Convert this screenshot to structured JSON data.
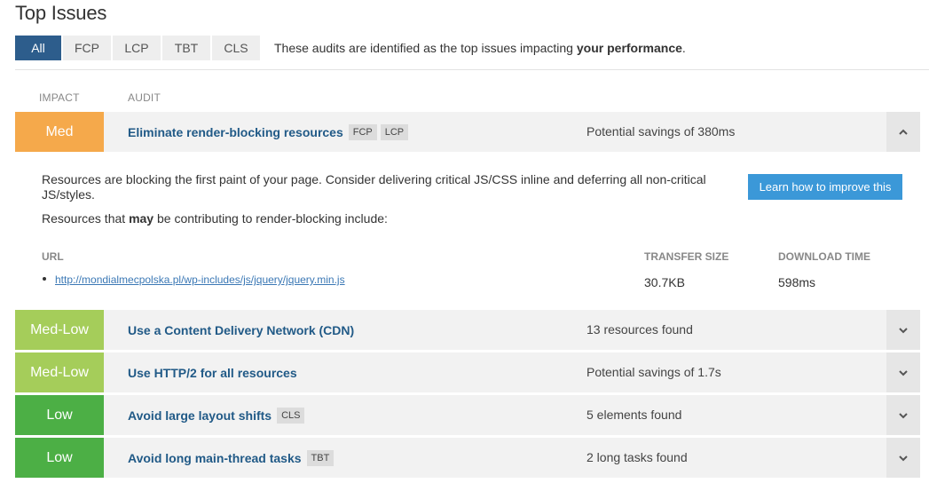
{
  "page": {
    "title": "Top Issues"
  },
  "filters": {
    "buttons": [
      "All",
      "FCP",
      "LCP",
      "TBT",
      "CLS"
    ],
    "description_prefix": "These audits are identified as the top issues impacting ",
    "description_bold": "your performance",
    "description_suffix": "."
  },
  "table": {
    "impact_header": "IMPACT",
    "audit_header": "AUDIT"
  },
  "rows": [
    {
      "impact": "Med",
      "color": "#f5a94b",
      "audit": "Eliminate render-blocking resources",
      "tags": [
        "FCP",
        "LCP"
      ],
      "result": "Potential savings of 380ms",
      "toggle_icon": "chevron-up-icon"
    },
    {
      "impact": "Med-Low",
      "color": "#a5cd5a",
      "audit": "Use a Content Delivery Network (CDN)",
      "tags": [],
      "result": "13 resources found",
      "toggle_icon": "chevron-down-icon"
    },
    {
      "impact": "Med-Low",
      "color": "#a5cd5a",
      "audit": "Use HTTP/2 for all resources",
      "tags": [],
      "result": "Potential savings of 1.7s",
      "toggle_icon": "chevron-down-icon"
    },
    {
      "impact": "Low",
      "color": "#4caf45",
      "audit": "Avoid large layout shifts",
      "tags": [
        "CLS"
      ],
      "result": "5 elements found",
      "toggle_icon": "chevron-down-icon"
    },
    {
      "impact": "Low",
      "color": "#4caf45",
      "audit": "Avoid long main-thread tasks",
      "tags": [
        "TBT"
      ],
      "result": "2 long tasks found",
      "toggle_icon": "chevron-down-icon"
    }
  ],
  "details": {
    "description": "Resources are blocking the first paint of your page. Consider delivering critical JS/CSS inline and deferring all non-critical JS/styles.",
    "contributing_prefix": "Resources that ",
    "contributing_bold": "may",
    "contributing_suffix": " be contributing to render-blocking include:",
    "learn_button": "Learn how to improve this",
    "columns": {
      "url": "URL",
      "transfer_size": "TRANSFER SIZE",
      "download_time": "DOWNLOAD TIME"
    },
    "resources": [
      {
        "url": "http://mondialmecpolska.pl/wp-includes/js/jquery/jquery.min.js",
        "transfer_size": "30.7KB",
        "download_time": "598ms"
      }
    ]
  }
}
